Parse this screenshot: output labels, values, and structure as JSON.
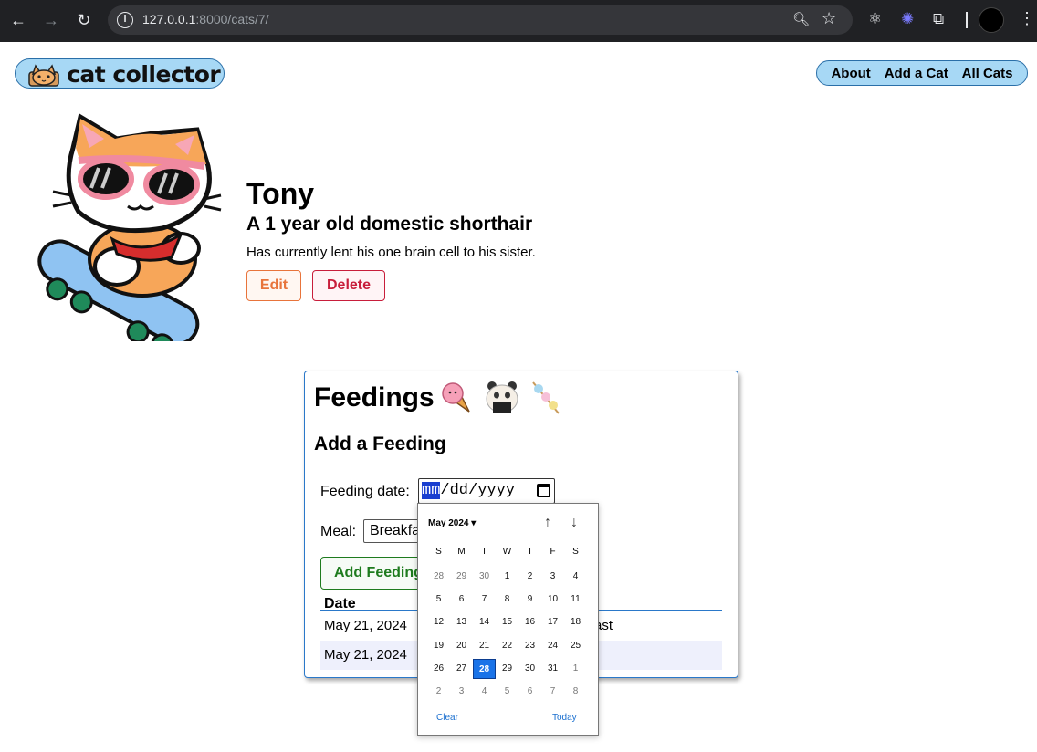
{
  "browser": {
    "url_host": "127.0.0.1",
    "url_rest": ":8000/cats/7/"
  },
  "site": {
    "logo_text": "cat collector",
    "nav": [
      "About",
      "Add a Cat",
      "All Cats"
    ]
  },
  "cat": {
    "name": "Tony",
    "subtitle": "A 1 year old domestic shorthair",
    "description": "Has currently lent his one brain cell to his sister.",
    "edit_label": "Edit",
    "delete_label": "Delete"
  },
  "feedings": {
    "title": "Feedings",
    "add_title": "Add a Feeding",
    "date_label": "Feeding date:",
    "date_placeholder_mm": "mm",
    "date_placeholder_rest": "/dd/yyyy",
    "meal_label": "Meal:",
    "meal_value": "Breakfast",
    "add_button": "Add Feeding",
    "table_header_date": "Date",
    "rows": [
      {
        "date": "May 21, 2024",
        "meal": "ast"
      },
      {
        "date": "May 21, 2024",
        "meal": ""
      }
    ]
  },
  "datepicker": {
    "month_label": "May 2024 ▾",
    "weekdays": [
      "S",
      "M",
      "T",
      "W",
      "T",
      "F",
      "S"
    ],
    "weeks": [
      [
        "28",
        "29",
        "30",
        "1",
        "2",
        "3",
        "4"
      ],
      [
        "5",
        "6",
        "7",
        "8",
        "9",
        "10",
        "11"
      ],
      [
        "12",
        "13",
        "14",
        "15",
        "16",
        "17",
        "18"
      ],
      [
        "19",
        "20",
        "21",
        "22",
        "23",
        "24",
        "25"
      ],
      [
        "26",
        "27",
        "28",
        "29",
        "30",
        "31",
        "1"
      ],
      [
        "2",
        "3",
        "4",
        "5",
        "6",
        "7",
        "8"
      ]
    ],
    "selected": "28",
    "clear_label": "Clear",
    "today_label": "Today"
  }
}
